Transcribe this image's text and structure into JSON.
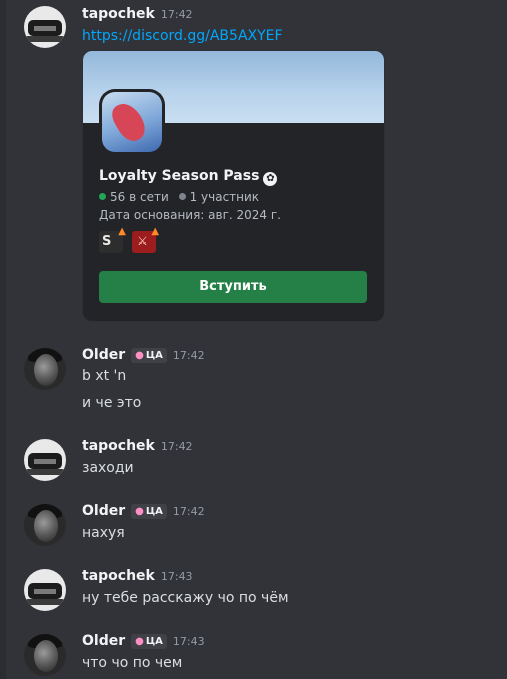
{
  "messages": [
    {
      "user": "tapochek",
      "time": "17:42",
      "link": "https://discord.gg/AB5AXYEF",
      "invite": {
        "server_name": "Loyalty Season Pass",
        "online": "56 в сети",
        "members": "1 участник",
        "founded": "Дата основания: авг. 2024 г.",
        "join_label": "Вступить"
      }
    },
    {
      "user": "Older",
      "tag": "ЦА",
      "time": "17:42",
      "lines": [
        "b xt 'n",
        "и че это"
      ]
    },
    {
      "user": "tapochek",
      "time": "17:42",
      "lines": [
        "заходи"
      ]
    },
    {
      "user": "Older",
      "tag": "ЦА",
      "time": "17:42",
      "lines": [
        "нахуя"
      ]
    },
    {
      "user": "tapochek",
      "time": "17:43",
      "lines": [
        "ну тебе расскажу чо по чём"
      ]
    },
    {
      "user": "Older",
      "tag": "ЦА",
      "time": "17:43",
      "lines": [
        "что чо по чем"
      ]
    }
  ],
  "colors": {
    "background": "#313338",
    "link": "#00a8fc",
    "join_button": "#248046",
    "online_dot": "#23a55a"
  },
  "icons": {
    "verified": "verified-badge-icon",
    "tag": "mushroom-icon"
  }
}
